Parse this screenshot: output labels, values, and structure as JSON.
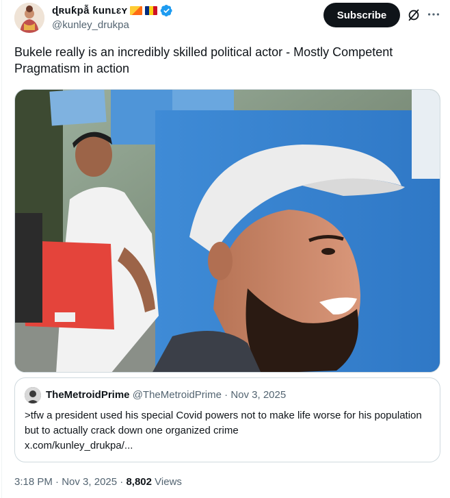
{
  "author": {
    "display_name": "ɖʀuƙpẫ ƙunʟɛʏ",
    "handle": "@kunley_drukpa",
    "flags": [
      "bhutan-flag",
      "romania-flag"
    ],
    "verified": true
  },
  "actions": {
    "subscribe_label": "Subscribe"
  },
  "tweet": {
    "text": "Bukele really is an incredibly skilled political actor - Mostly Competent Pragmatism in action"
  },
  "quote": {
    "name": "TheMetroidPrime",
    "handle": "@TheMetroidPrime",
    "separator": "·",
    "date": "Nov 3, 2025",
    "text": ">tfw a president used his special Covid powers not to make life worse for his population but to actually crack down one organized crime",
    "link": "x.com/kunley_drukpa/..."
  },
  "footer": {
    "time": "3:18 PM",
    "separator": "·",
    "date": "Nov 3, 2025",
    "views_count": "8,802",
    "views_label": "Views"
  },
  "colors": {
    "text_primary": "#0f1419",
    "text_secondary": "#536471",
    "border": "#cfd9de",
    "verified_blue": "#1d9bf0",
    "subscribe_bg": "#0f1419"
  }
}
